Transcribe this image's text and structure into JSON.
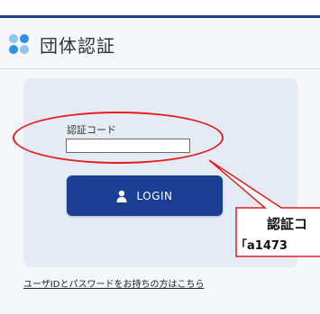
{
  "header": {
    "title": "団体認証"
  },
  "login_form": {
    "code_label": "認証コード",
    "code_value": "",
    "login_button_label": "LOGIN",
    "help_link": "ユーザIDとパスワードをお持ちの方はこちら"
  },
  "annotation": {
    "line1": "認証コ",
    "line2": "「a1473",
    "color": "#e81d1d"
  },
  "colors": {
    "brand": "#1e3f8c",
    "button": "#1a3f93",
    "panel": "#e4ebf4",
    "icon_primary": "#2f8fe0",
    "icon_light": "#8cc7f3"
  },
  "icons": {
    "title_icon": "four-dots-icon",
    "button_icon": "user-icon"
  }
}
